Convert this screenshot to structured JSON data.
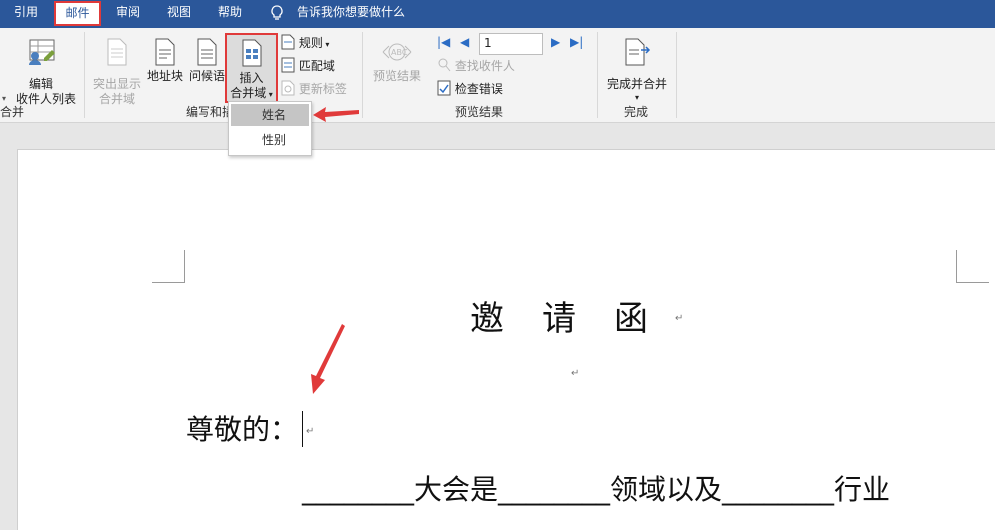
{
  "tabs": [
    {
      "label": "引用"
    },
    {
      "label": "邮件"
    },
    {
      "label": "审阅"
    },
    {
      "label": "视图"
    },
    {
      "label": "帮助"
    }
  ],
  "tell_me": "告诉我你想要做什么",
  "ribbon": {
    "edit_recipients": {
      "line1": "编辑",
      "line2": "收件人列表"
    },
    "start_group_cut": "合并",
    "highlight": {
      "line1": "突出显示",
      "line2": "合并域"
    },
    "address_block": "地址块",
    "greeting_line": "问候语",
    "insert_field": {
      "line1": "插入",
      "line2": "合并域"
    },
    "rules": "规则",
    "match_fields": "匹配域",
    "update_labels": "更新标签",
    "group_write": "编写和插",
    "preview_results": "预览结果",
    "record_number": "1",
    "find_recipient": "查找收件人",
    "check_errors": "检查错误",
    "group_preview": "预览结果",
    "finish_merge": "完成并合并",
    "group_finish": "完成"
  },
  "dropdown": [
    {
      "label": "姓名"
    },
    {
      "label": "性别"
    }
  ],
  "document": {
    "title": "邀　请　函",
    "salutation": "尊敬的：",
    "body_line": "________大会是________领域以及________行业"
  },
  "colors": {
    "ribbon_tab_bar": "#2b579a",
    "highlight_red": "#e03a3a"
  }
}
